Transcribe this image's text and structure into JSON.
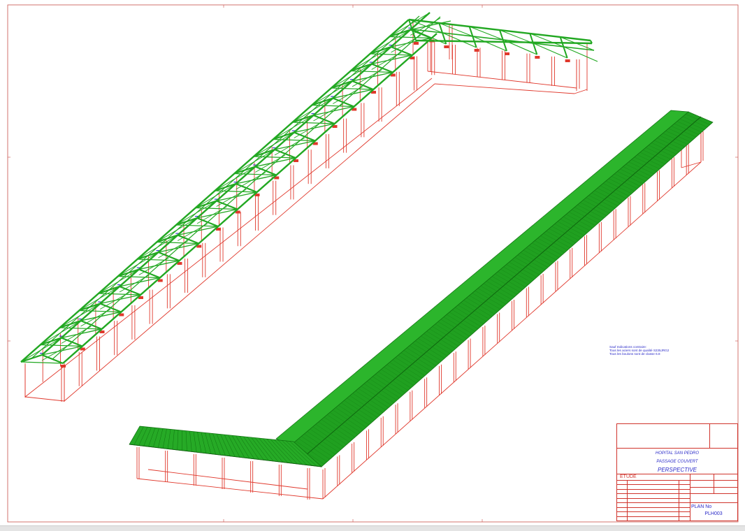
{
  "notes": {
    "lines": [
      "Sauf Indications contraire:",
      "Tous les aciers sont de qualité S235JRG2",
      "Tous les boulons sont de classe 6.8"
    ]
  },
  "title_block": {
    "project": "HOPITAL SAN PEDRO",
    "subject": "PASSAGE COUVERT",
    "view": "PERSPECTIVE",
    "phase": "ETUDE",
    "plan_label": "PLAN No",
    "plan_number": "PLH003"
  },
  "colors": {
    "structure_green": "#22a822",
    "columns_red": "#e0382c",
    "annotation_blue": "#2a2ac8",
    "frame_red": "#c8504a"
  }
}
